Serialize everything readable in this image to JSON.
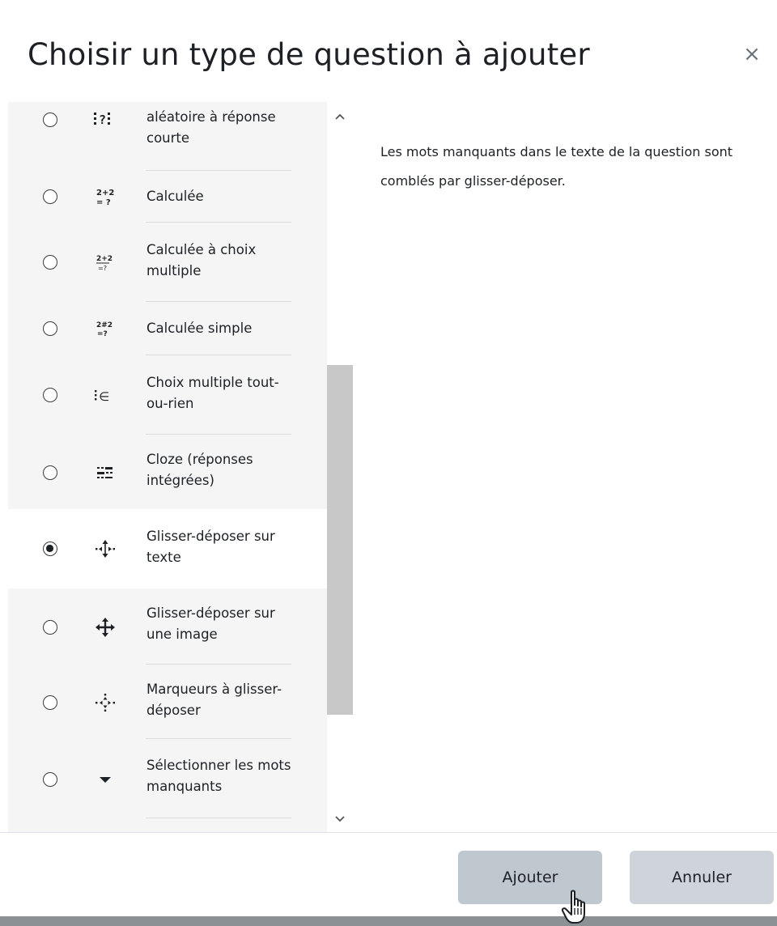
{
  "modal": {
    "title": "Choisir un type de question à ajouter",
    "close_symbol": "×"
  },
  "question_types": [
    {
      "label": "aléatoire à réponse courte",
      "icon": "random-short-answer-icon",
      "selected": false
    },
    {
      "label": "Calculée",
      "icon": "calculated-icon",
      "selected": false
    },
    {
      "label": "Calculée à choix multiple",
      "icon": "calculated-multichoice-icon",
      "selected": false
    },
    {
      "label": "Calculée simple",
      "icon": "calculated-simple-icon",
      "selected": false
    },
    {
      "label": "Choix multiple tout-ou-rien",
      "icon": "multichoice-all-or-nothing-icon",
      "selected": false
    },
    {
      "label": "Cloze (réponses intégrées)",
      "icon": "cloze-icon",
      "selected": false
    },
    {
      "label": "Glisser-déposer sur texte",
      "icon": "drag-drop-text-icon",
      "selected": true
    },
    {
      "label": "Glisser-déposer sur une image",
      "icon": "drag-drop-image-icon",
      "selected": false
    },
    {
      "label": "Marqueurs à glisser-déposer",
      "icon": "drag-drop-markers-icon",
      "selected": false
    },
    {
      "label": "Sélectionner les mots manquants",
      "icon": "select-missing-words-icon",
      "selected": false
    }
  ],
  "description": {
    "text": "Les mots manquants dans le texte de la question sont comblés par glisser-déposer."
  },
  "footer": {
    "add_label": "Ajouter",
    "cancel_label": "Annuler"
  }
}
